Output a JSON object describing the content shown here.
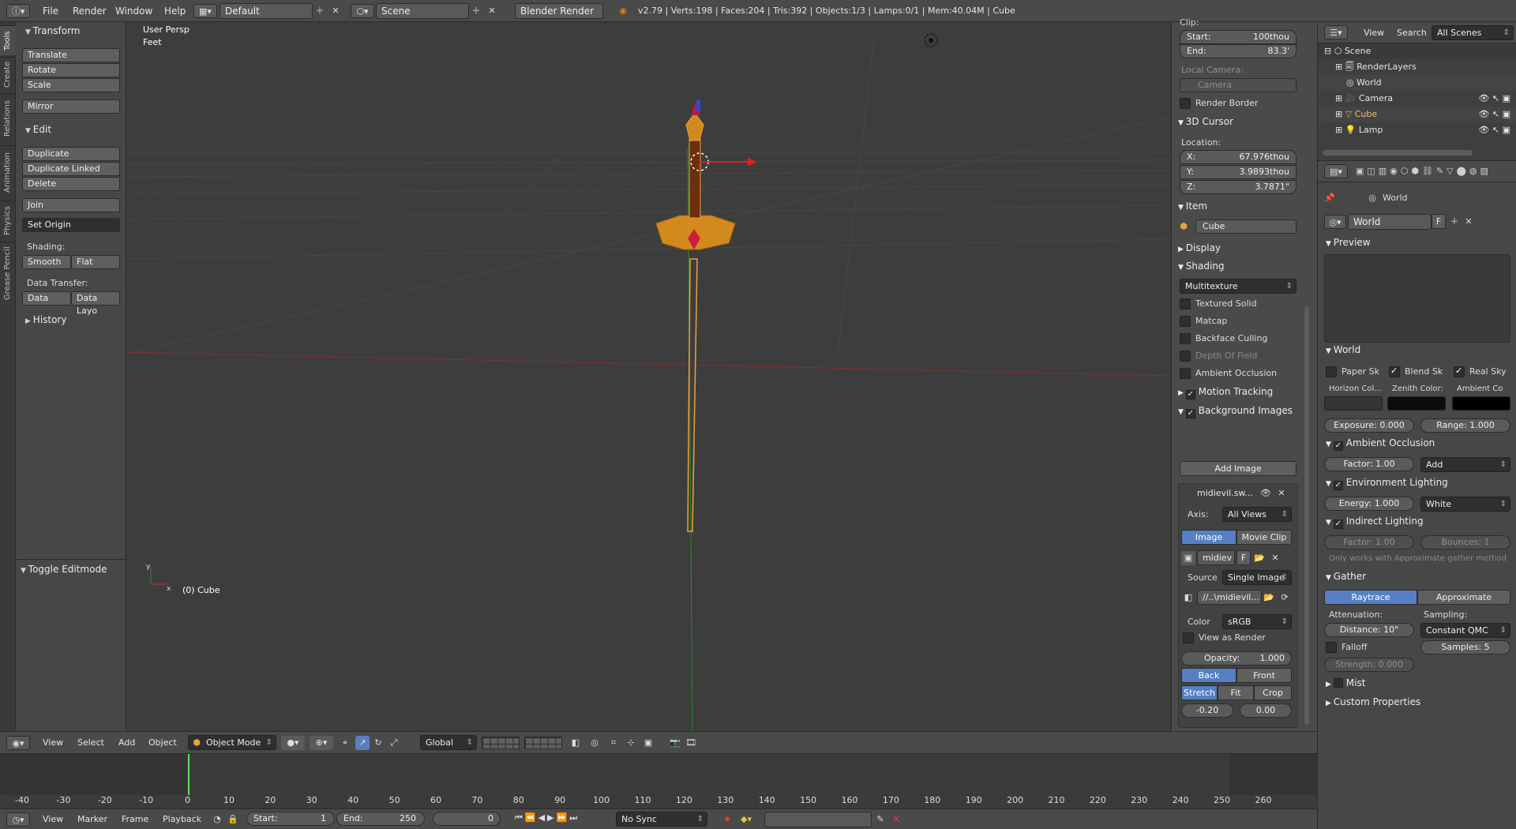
{
  "top_header": {
    "menus": [
      "File",
      "Render",
      "Window",
      "Help"
    ],
    "layout": "Default",
    "scene": "Scene",
    "engine": "Blender Render",
    "stats": "v2.79 | Verts:198 | Faces:204 | Tris:392 | Objects:1/3 | Lamps:0/1 | Mem:40.04M | Cube"
  },
  "tool_tabs": [
    "Tools",
    "Create",
    "Relations",
    "Animation",
    "Physics",
    "Grease Pencil"
  ],
  "tool_shelf": {
    "transform": {
      "title": "Transform",
      "buttons": [
        "Translate",
        "Rotate",
        "Scale",
        "Mirror"
      ]
    },
    "edit": {
      "title": "Edit",
      "buttons": [
        "Duplicate",
        "Duplicate Linked",
        "Delete",
        "Join"
      ],
      "set_origin": "Set Origin"
    },
    "shading": {
      "label": "Shading:",
      "smooth": "Smooth",
      "flat": "Flat"
    },
    "data_transfer": {
      "label": "Data Transfer:",
      "data": "Data",
      "data_layout": "Data Layo"
    },
    "history": "History",
    "toggle_editmode": "Toggle Editmode"
  },
  "viewport": {
    "view_name": "User Persp",
    "units": "Feet",
    "object_label": "(0) Cube"
  },
  "n_panel": {
    "clip": "Clip:",
    "start_label": "Start:",
    "start_value": "100thou",
    "end_label": "End:",
    "end_value": "83.3'",
    "local_camera": "Local Camera:",
    "camera_field": "Camera",
    "render_border": "Render Border",
    "cursor": {
      "title": "3D Cursor",
      "location": "Location:",
      "x": "67.976thou",
      "y": "3.9893thou",
      "z": "3.7871\""
    },
    "item": {
      "title": "Item",
      "name": "Cube"
    },
    "display": "Display",
    "shading": {
      "title": "Shading",
      "mode": "Multitexture",
      "options": [
        "Textured Solid",
        "Matcap",
        "Backface Culling",
        "Depth Of Field",
        "Ambient Occlusion"
      ]
    },
    "motion_tracking": "Motion Tracking",
    "background_images": "Background Images",
    "add_image": "Add Image",
    "bg": {
      "name": "midievil.sw...",
      "axis_label": "Axis:",
      "axis": "All Views",
      "image": "Image",
      "movie_clip": "Movie Clip",
      "file": "midiev",
      "f": "F",
      "source_label": "Source",
      "source": "Single Image",
      "path": "//..\\midievil...",
      "color_label": "Color",
      "color": "sRGB",
      "view_as_render": "View as Render",
      "opacity": "Opacity:",
      "opacity_value": "1.000",
      "back": "Back",
      "front": "Front",
      "stretch": "Stretch",
      "fit": "Fit",
      "crop": "Crop",
      "offset_x": "-0.20",
      "offset_y": "0.00"
    }
  },
  "outliner": {
    "view": "View",
    "search": "Search",
    "filter": "All Scenes",
    "items": [
      "Scene",
      "RenderLayers",
      "World",
      "Camera",
      "Cube",
      "Lamp"
    ]
  },
  "properties": {
    "breadcrumb": "World",
    "world_name": "World",
    "f": "F",
    "preview": "Preview",
    "world": {
      "title": "World",
      "paper_sky": "Paper Sk",
      "blend_sky": "Blend Sk",
      "real_sky": "Real Sky",
      "horizon": "Horizon Col...",
      "zenith": "Zenith Color:",
      "ambient": "Ambient Co",
      "exposure": "Exposure:",
      "exposure_value": "0.000",
      "range": "Range:",
      "range_value": "1.000"
    },
    "ao": {
      "title": "Ambient Occlusion",
      "factor": "Factor:",
      "factor_value": "1.00",
      "mode": "Add"
    },
    "env": {
      "title": "Environment Lighting",
      "energy": "Energy:",
      "energy_value": "1.000",
      "color": "White"
    },
    "indirect": {
      "title": "Indirect Lighting",
      "factor": "Factor:",
      "factor_value": "1.00",
      "bounces": "Bounces:",
      "bounces_value": "1",
      "note": "Only works with Approximate gather method"
    },
    "gather": {
      "title": "Gather",
      "raytrace": "Raytrace",
      "approximate": "Approximate",
      "attenuation": "Attenuation:",
      "sampling": "Sampling:",
      "distance": "Distance:",
      "distance_value": "10\"",
      "method": "Constant QMC",
      "falloff": "Falloff",
      "samples": "Samples:",
      "samples_value": "5",
      "strength": "Strength:",
      "strength_value": "0.000"
    },
    "mist": "Mist",
    "custom": "Custom Properties"
  },
  "viewport_header": {
    "menus": [
      "View",
      "Select",
      "Add",
      "Object"
    ],
    "mode": "Object Mode",
    "orientation": "Global"
  },
  "timeline": {
    "ticks": [
      "-40",
      "-30",
      "-20",
      "-10",
      "0",
      "10",
      "20",
      "30",
      "40",
      "50",
      "60",
      "70",
      "80",
      "90",
      "100",
      "110",
      "120",
      "130",
      "140",
      "150",
      "160",
      "170",
      "180",
      "190",
      "200",
      "210",
      "220",
      "230",
      "240",
      "250",
      "260"
    ]
  },
  "timeline_header": {
    "menus": [
      "View",
      "Marker",
      "Frame",
      "Playback"
    ],
    "start_label": "Start:",
    "start": "1",
    "end_label": "End:",
    "end": "250",
    "current": "0",
    "sync": "No Sync"
  }
}
